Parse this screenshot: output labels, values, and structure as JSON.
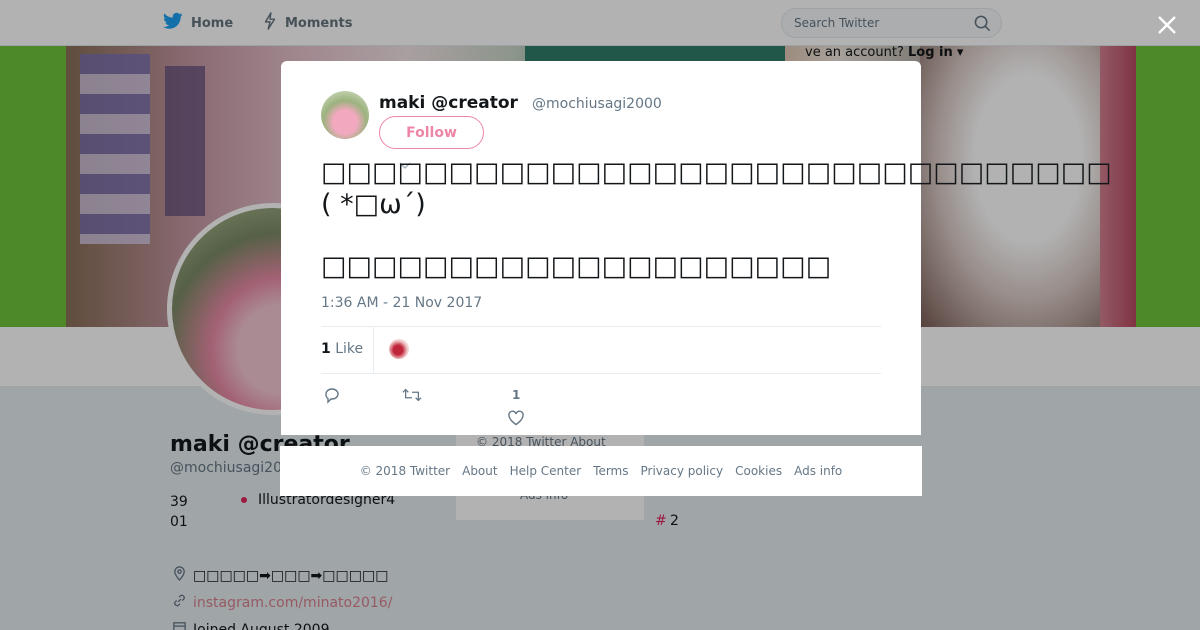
{
  "nav": {
    "home_label": "Home",
    "moments_label": "Moments",
    "search_placeholder": "Search Twitter",
    "have_account_text": "ve an account?",
    "login_label": "Log in",
    "login_caret": "▾"
  },
  "profile": {
    "name": "maki @creator",
    "handle": "@mochiusagi20",
    "stat_number": "39\n01",
    "stat_word": "Illustratordesigner4",
    "location": "□□□□□➡□□□➡□□□□□",
    "link": "instagram.com/minato2016/",
    "joined": "Joined August 2009",
    "hash_symbol": "#",
    "hash_count": "2"
  },
  "side_card": {
    "line1": "© 2018 Twitter   About",
    "line2": "Ads info"
  },
  "tweet": {
    "author_name": "maki @creator",
    "author_handle": "@mochiusagi2000",
    "follow_label": "Follow",
    "text_line1": "□□□□□□□□□□□□□□□□□□□□□□□□□□□□□□□",
    "text_line2": "( *□ω´)",
    "text_line3": "□□□□□□□□□□□□□□□□□□□□",
    "timestamp": "1:36 AM - 21 Nov 2017",
    "like_count": "1",
    "like_label": "Like",
    "action_like_count": "1"
  },
  "footer": {
    "items": [
      "© 2018 Twitter",
      "About",
      "Help Center",
      "Terms",
      "Privacy policy",
      "Cookies",
      "Ads info"
    ]
  },
  "colors": {
    "accent": "#e0245e",
    "banner_green": "#6fc43a",
    "text_secondary": "#657786"
  },
  "icons": {
    "home": "twitter-bird-icon",
    "moments": "lightning-icon",
    "search": "search-icon",
    "close": "close-icon",
    "reply": "reply-icon",
    "retweet": "retweet-icon",
    "like": "heart-icon",
    "location": "location-pin-icon",
    "link": "link-icon",
    "calendar": "calendar-icon"
  }
}
